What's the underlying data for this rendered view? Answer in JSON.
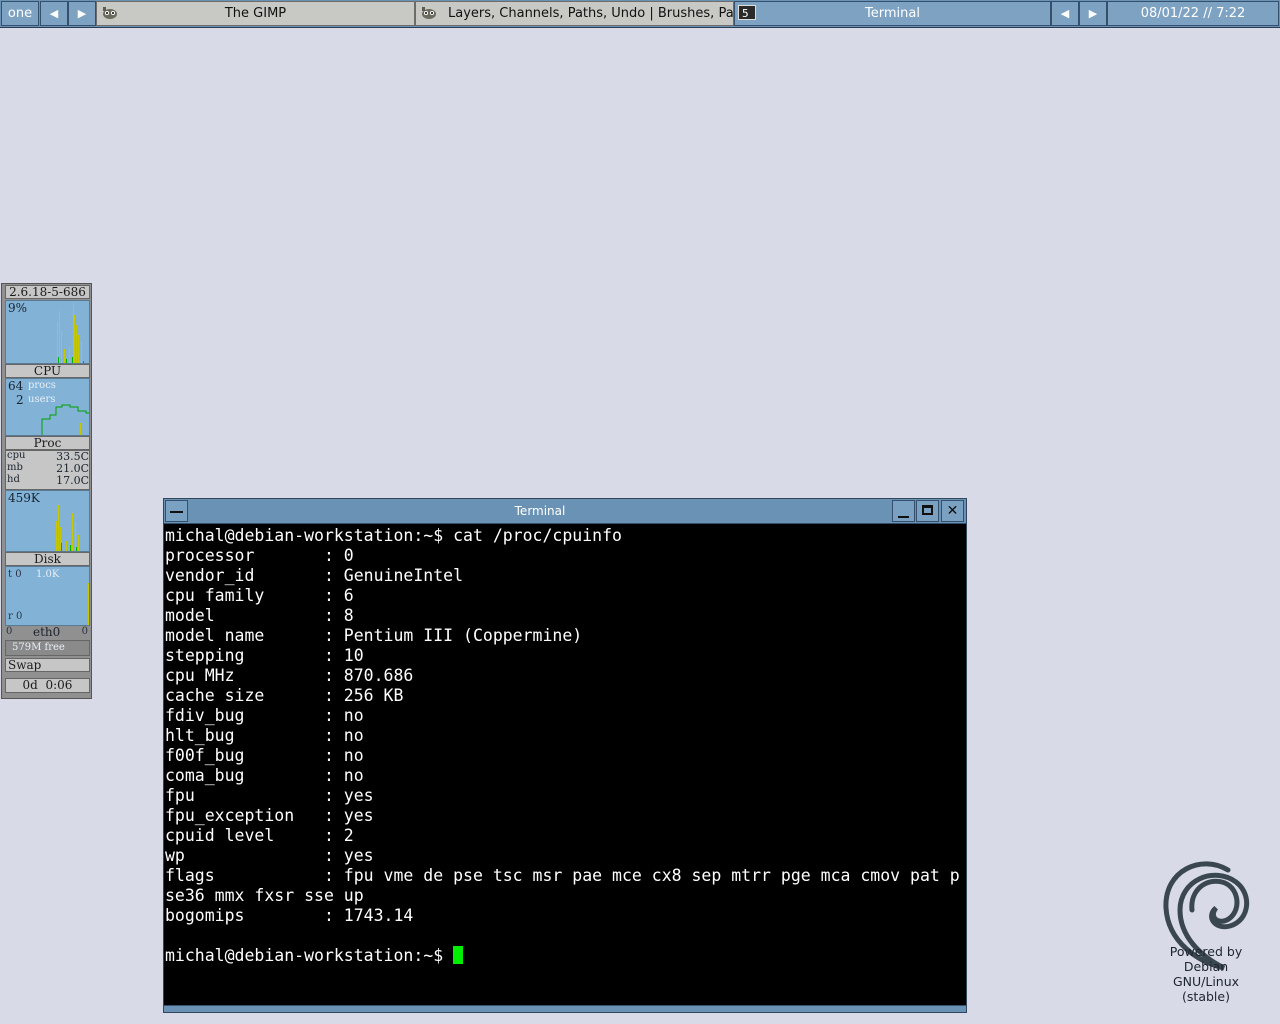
{
  "taskbar": {
    "desktop_name": "one",
    "prev_desktop_icon": "left-arrow",
    "next_desktop_icon": "right-arrow",
    "tasks": [
      {
        "label": "The GIMP",
        "icon": "gimp-icon",
        "state": "inactive"
      },
      {
        "label": "Layers, Channels, Paths, Undo | Brushes, Patter",
        "icon": "gimp-icon",
        "state": "inactive"
      },
      {
        "label": "Terminal",
        "icon": "terminal-icon",
        "state": "active"
      }
    ],
    "task_prev_icon": "left-arrow",
    "task_next_icon": "right-arrow",
    "clock": "08/01/22 // 7:22"
  },
  "monitor": {
    "kernel": "2.6.18-5-686",
    "cpu_percent": "9%",
    "cpu_label": "CPU",
    "procs_count": "64",
    "procs_label": "procs",
    "users_count": "2",
    "users_label": "users",
    "proc_label": "Proc",
    "sensors": [
      {
        "name": "cpu",
        "value": "33.5C"
      },
      {
        "name": "mb",
        "value": "21.0C"
      },
      {
        "name": "hd",
        "value": "17.0C"
      }
    ],
    "disk_rate": "459K",
    "disk_label": "Disk",
    "net_tx_label": "t 0",
    "net_scale": "1.0K",
    "net_rx_label": "r 0",
    "net_left": "0",
    "net_iface": "eth0",
    "net_right": "0",
    "swap_free": "579M free",
    "swap_label": "Swap",
    "uptime": "0d  0:06"
  },
  "terminal": {
    "title": "Terminal",
    "minimize_icon": "minimize-icon",
    "maximize_icon": "maximize-icon",
    "close_icon": "close-icon",
    "lines": [
      "michal@debian-workstation:~$ cat /proc/cpuinfo",
      "processor       : 0",
      "vendor_id       : GenuineIntel",
      "cpu family      : 6",
      "model           : 8",
      "model name      : Pentium III (Coppermine)",
      "stepping        : 10",
      "cpu MHz         : 870.686",
      "cache size      : 256 KB",
      "fdiv_bug        : no",
      "hlt_bug         : no",
      "f00f_bug        : no",
      "coma_bug        : no",
      "fpu             : yes",
      "fpu_exception   : yes",
      "cpuid level     : 2",
      "wp              : yes",
      "flags           : fpu vme de pse tsc msr pae mce cx8 sep mtrr pge mca cmov pat p",
      "se36 mmx fxsr sse up",
      "bogomips        : 1743.14",
      ""
    ],
    "prompt": "michal@debian-workstation:~$ "
  },
  "debian_logo": {
    "icon": "debian-swirl-icon",
    "line1": "Powered by",
    "line2": "Debian",
    "line3": "GNU/Linux",
    "line4": "(stable)"
  },
  "colors": {
    "desktop": "#d8dbe7",
    "titlebar": "#6a92b5",
    "terminal_bg": "#000000",
    "cursor": "#00ee00",
    "graph_bg": "#82b2d6"
  }
}
